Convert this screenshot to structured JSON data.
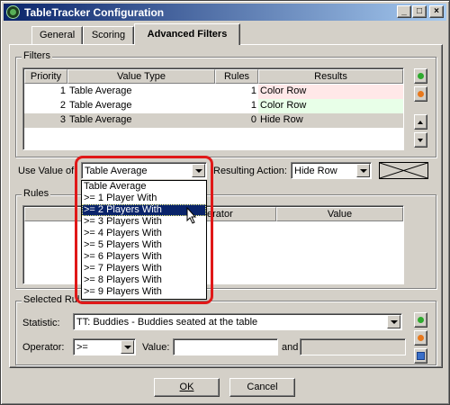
{
  "window": {
    "title": "TableTracker Configuration",
    "controls": {
      "minimize": "_",
      "maximize": "□",
      "close": "×"
    }
  },
  "tabs": [
    {
      "label": "General"
    },
    {
      "label": "Scoring"
    },
    {
      "label": "Advanced Filters"
    }
  ],
  "filters": {
    "group_label": "Filters",
    "columns": [
      "Priority",
      "Value Type",
      "Rules",
      "Results"
    ],
    "rows": [
      {
        "priority": "1",
        "value_type": "Table Average",
        "rules": "1",
        "result": "Color Row",
        "result_color": "#ffe8e8"
      },
      {
        "priority": "2",
        "value_type": "Table Average",
        "rules": "1",
        "result": "Color Row",
        "result_color": "#e8ffe8"
      },
      {
        "priority": "3",
        "value_type": "Table Average",
        "rules": "0",
        "result": "Hide Row",
        "result_color": "#d4d0c8"
      }
    ],
    "side_buttons": {
      "add_icon": "green-plus-icon",
      "remove_icon": "orange-minus-icon",
      "up_icon": "arrow-up-icon",
      "down_icon": "arrow-down-icon"
    }
  },
  "use_value": {
    "label": "Use Value of:",
    "selected": "Table Average",
    "options": [
      "Table Average",
      ">= 1 Player With",
      ">= 2 Players With",
      ">= 3 Players With",
      ">= 4 Players With",
      ">= 5 Players With",
      ">= 6 Players With",
      ">= 7 Players With",
      ">= 8 Players With",
      ">= 9 Players With"
    ],
    "highlighted_option": ">= 2 Players With"
  },
  "resulting_action": {
    "label": "Resulting Action:",
    "selected": "Hide Row"
  },
  "rules": {
    "group_label": "Rules",
    "columns": [
      "",
      "erator",
      "Value"
    ]
  },
  "selected_rule": {
    "group_label": "Selected Rul",
    "statistic_label": "Statistic:",
    "statistic_value": "TT: Buddies - Buddies seated at the table",
    "operator_label": "Operator:",
    "operator_value": ">=",
    "value_label": "Value:",
    "value_value": "",
    "and_label": "and",
    "and_value": ""
  },
  "buttons": {
    "ok": "OK",
    "cancel": "Cancel"
  },
  "colors": {
    "highlight_ring": "#e01818",
    "selection": "#0a246a",
    "titlebar_start": "#0a246a",
    "titlebar_end": "#a6caf0",
    "add_green": "#2eaa2e",
    "remove_orange": "#e8781c"
  }
}
